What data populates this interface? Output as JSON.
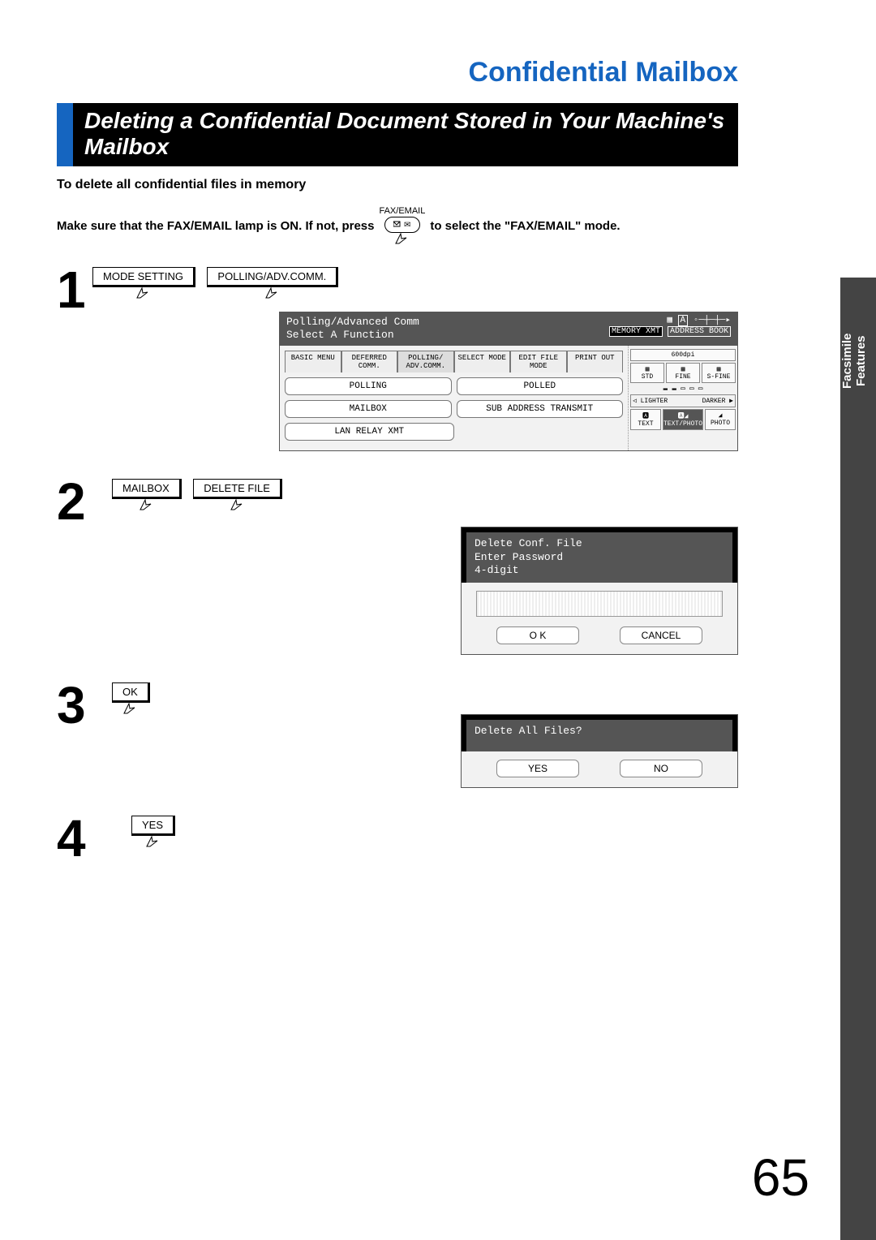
{
  "chapter_title": "Confidential Mailbox",
  "section_title": "Deleting a Confidential Document Stored in Your Machine's Mailbox",
  "subhead": "To delete all confidential files in memory",
  "instr_pre": "Make sure that the FAX/EMAIL lamp is ON.  If not, press",
  "instr_post": "to select the \"FAX/EMAIL\" mode.",
  "fax_btn_label": "FAX/EMAIL",
  "side_tab": "Facsimile\nFeatures",
  "steps": {
    "1": {
      "btn1": "MODE SETTING",
      "btn2": "POLLING/ADV.COMM."
    },
    "2": {
      "btn1": "MAILBOX",
      "btn2": "DELETE FILE"
    },
    "3": {
      "btn1": "OK"
    },
    "4": {
      "btn1": "YES"
    }
  },
  "screen1": {
    "title_l1": "Polling/Advanced Comm",
    "title_l2": "Select A Function",
    "top_btn_memory": "MEMORY XMT",
    "top_btn_addr": "ADDRESS BOOK",
    "tabs": [
      "BASIC MENU",
      "DEFERRED COMM.",
      "POLLING/ ADV.COMM.",
      "SELECT MODE",
      "EDIT FILE MODE",
      "PRINT OUT"
    ],
    "fn": {
      "polling": "POLLING",
      "polled": "POLLED",
      "mailbox": "MAILBOX",
      "sub_addr": "SUB ADDRESS TRANSMIT",
      "lan": "LAN RELAY XMT"
    },
    "dpi": "600dpi",
    "res": [
      "STD",
      "FINE",
      "S-FINE"
    ],
    "lighter": "LIGHTER",
    "darker": "DARKER",
    "orig": [
      "TEXT",
      "TEXT/PHOTO",
      "PHOTO"
    ]
  },
  "screen2": {
    "l1": "Delete Conf. File",
    "l2": "Enter Password",
    "l3": "4-digit",
    "ok": "O K",
    "cancel": "CANCEL"
  },
  "screen3": {
    "l1": "Delete All Files?",
    "yes": "YES",
    "no": "NO"
  },
  "page_num": "65"
}
